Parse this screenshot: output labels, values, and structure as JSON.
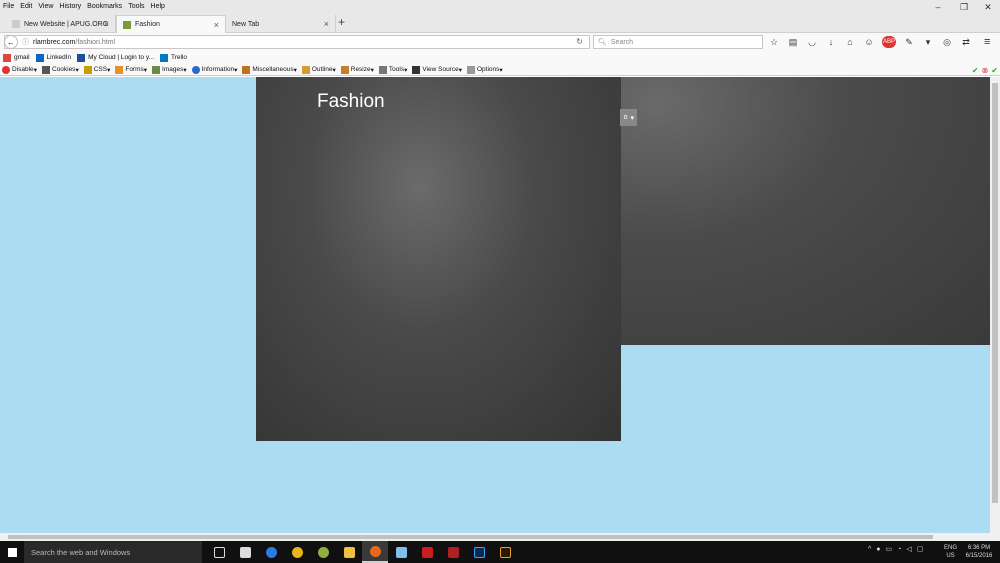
{
  "menu": [
    "File",
    "Edit",
    "View",
    "History",
    "Bookmarks",
    "Tools",
    "Help"
  ],
  "tabs": [
    {
      "label": "New Website | APUG.ORG"
    },
    {
      "label": "Fashion"
    },
    {
      "label": "New Tab"
    }
  ],
  "nav": {
    "url_host": "rlambrec.com",
    "url_path": "/fashion.html",
    "search_placeholder": "Search"
  },
  "bookmarks": [
    "gmail",
    "LinkedIn",
    "My Cloud | Login to y...",
    "Trello"
  ],
  "devbar": [
    "Disable",
    "Cookies",
    "CSS",
    "Forms",
    "Images",
    "Information",
    "Miscellaneous",
    "Outline",
    "Resize",
    "Tools",
    "View Source",
    "Options"
  ],
  "page": {
    "title": "Fashion",
    "dropdown_text": "o"
  },
  "taskbar": {
    "search_placeholder": "Search the web and Windows",
    "lang_line1": "ENG",
    "lang_line2": "US",
    "time": "6:36 PM",
    "date": "6/15/2016"
  },
  "colors": {
    "page_background": "#abdcf2",
    "panel_dark": "#3a3a3a"
  }
}
